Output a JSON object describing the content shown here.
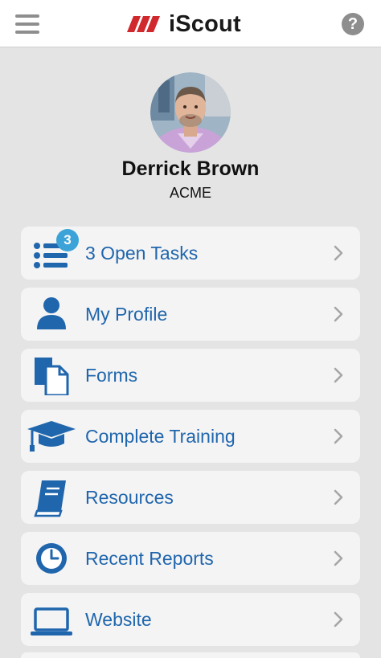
{
  "header": {
    "logo_text": "iScout",
    "help_symbol": "?",
    "colors": {
      "logo_red": "#d0282c",
      "icon_gray": "#8e8e8e"
    }
  },
  "profile": {
    "name": "Derrick Brown",
    "company": "ACME"
  },
  "menu": {
    "accent_color": "#2066ad",
    "badge_color": "#3ca3d8",
    "items": [
      {
        "label": "3 Open Tasks",
        "icon": "task-list-icon",
        "badge": "3"
      },
      {
        "label": "My Profile",
        "icon": "person-icon"
      },
      {
        "label": "Forms",
        "icon": "documents-icon"
      },
      {
        "label": "Complete Training",
        "icon": "graduation-cap-icon"
      },
      {
        "label": "Resources",
        "icon": "book-icon"
      },
      {
        "label": "Recent Reports",
        "icon": "clock-icon"
      },
      {
        "label": "Website",
        "icon": "laptop-icon"
      }
    ]
  }
}
